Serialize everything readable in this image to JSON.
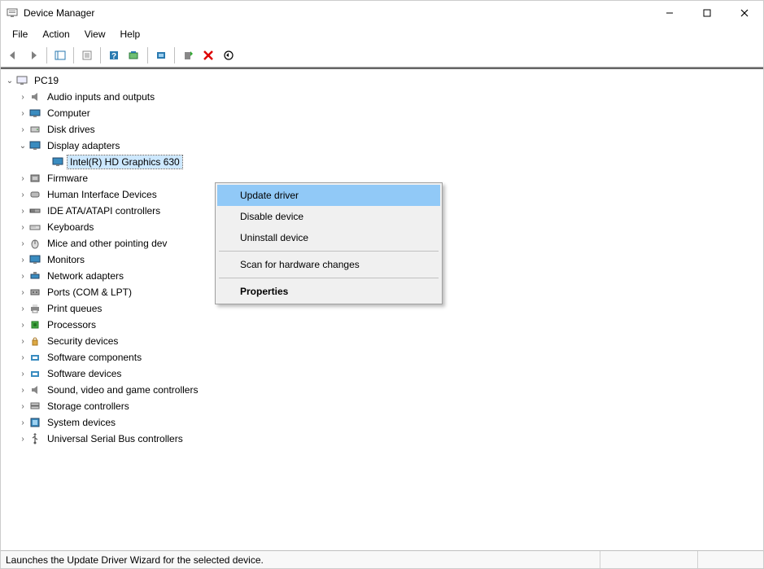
{
  "window": {
    "title": "Device Manager"
  },
  "menubar": {
    "items": [
      {
        "label": "File"
      },
      {
        "label": "Action"
      },
      {
        "label": "View"
      },
      {
        "label": "Help"
      }
    ]
  },
  "tree": {
    "root": {
      "label": "PC19",
      "expanded": true
    },
    "items": [
      {
        "label": "Audio inputs and outputs",
        "icon": "audio",
        "expandable": true
      },
      {
        "label": "Computer",
        "icon": "computer",
        "expandable": true
      },
      {
        "label": "Disk drives",
        "icon": "disk",
        "expandable": true
      },
      {
        "label": "Display adapters",
        "icon": "display",
        "expandable": true,
        "expanded": true,
        "children": [
          {
            "label": "Intel(R) HD Graphics 630",
            "icon": "display",
            "selected": true
          }
        ]
      },
      {
        "label": "Firmware",
        "icon": "firmware",
        "expandable": true
      },
      {
        "label": "Human Interface Devices",
        "icon": "hid",
        "expandable": true
      },
      {
        "label": "IDE ATA/ATAPI controllers",
        "icon": "ide",
        "expandable": true
      },
      {
        "label": "Keyboards",
        "icon": "keyboard",
        "expandable": true
      },
      {
        "label": "Mice and other pointing devices",
        "icon": "mouse",
        "expandable": true,
        "truncated": "Mice and other pointing dev"
      },
      {
        "label": "Monitors",
        "icon": "display",
        "expandable": true
      },
      {
        "label": "Network adapters",
        "icon": "network",
        "expandable": true
      },
      {
        "label": "Ports (COM & LPT)",
        "icon": "port",
        "expandable": true
      },
      {
        "label": "Print queues",
        "icon": "printer",
        "expandable": true
      },
      {
        "label": "Processors",
        "icon": "cpu",
        "expandable": true
      },
      {
        "label": "Security devices",
        "icon": "security",
        "expandable": true
      },
      {
        "label": "Software components",
        "icon": "software",
        "expandable": true
      },
      {
        "label": "Software devices",
        "icon": "software",
        "expandable": true
      },
      {
        "label": "Sound, video and game controllers",
        "icon": "audio",
        "expandable": true
      },
      {
        "label": "Storage controllers",
        "icon": "storage",
        "expandable": true
      },
      {
        "label": "System devices",
        "icon": "system",
        "expandable": true
      },
      {
        "label": "Universal Serial Bus controllers",
        "icon": "usb",
        "expandable": true
      }
    ]
  },
  "contextmenu": {
    "items": [
      {
        "label": "Update driver",
        "highlight": true
      },
      {
        "label": "Disable device"
      },
      {
        "label": "Uninstall device"
      },
      {
        "sep": true
      },
      {
        "label": "Scan for hardware changes"
      },
      {
        "sep": true
      },
      {
        "label": "Properties",
        "bold": true
      }
    ]
  },
  "statusbar": {
    "text": "Launches the Update Driver Wizard for the selected device."
  },
  "icons": {
    "expander_collapsed": "▶",
    "expander_expanded": "▽"
  }
}
